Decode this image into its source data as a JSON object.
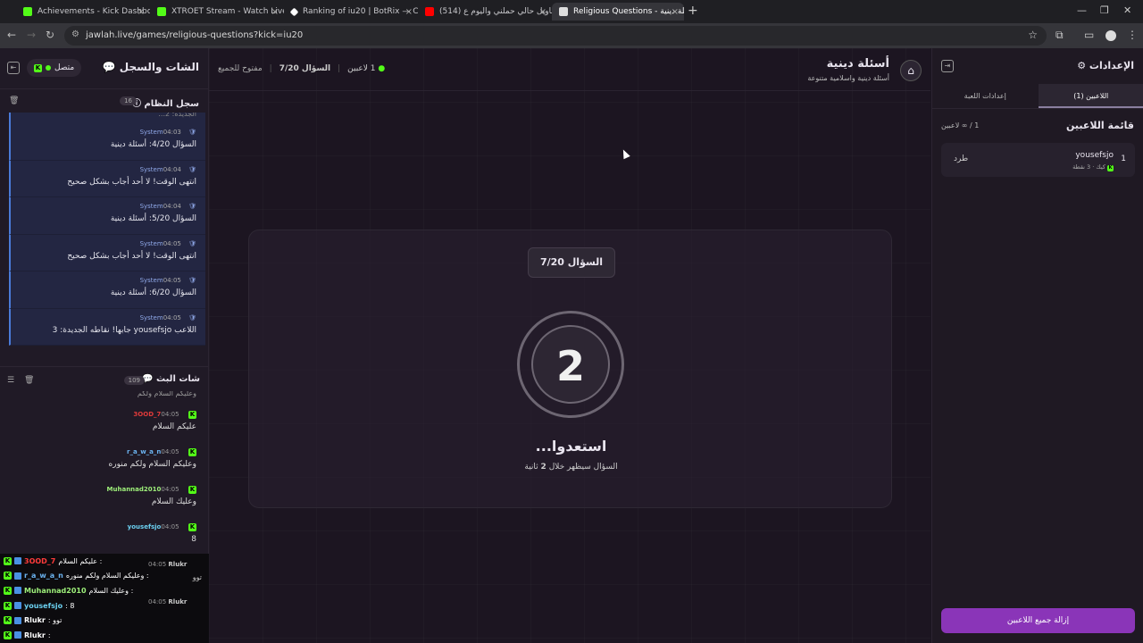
{
  "browser": {
    "tabs": [
      {
        "title": "Achievements - Kick Dashboard",
        "color": "#53fc18"
      },
      {
        "title": "XTROET Stream - Watch Live o",
        "color": "#53fc18"
      },
      {
        "title": "Ranking of iu20 | BotRix — Clou",
        "color": "#ffffff"
      },
      {
        "title": "(514) باويل حالي حملني واليوم ع",
        "color": "#ff0000"
      },
      {
        "title": "Religious Questions - أسئلة دينية",
        "color": "#ffffff"
      }
    ],
    "url": "jawlah.live/games/religious-questions?kick=iu20"
  },
  "left": {
    "title": "الشات والسجل",
    "online": "متصل",
    "system": {
      "title": "سجل النظام",
      "count": "16",
      "partial": "...الجديدة: 2",
      "messages": [
        {
          "sender": "System",
          "time": "04:03",
          "text": "السؤال 4/20: أسئلة دينية"
        },
        {
          "sender": "System",
          "time": "04:04",
          "text": "انتهى الوقت! لا أحد أجاب بشكل صحيح"
        },
        {
          "sender": "System",
          "time": "04:04",
          "text": "السؤال 5/20: أسئلة دينية"
        },
        {
          "sender": "System",
          "time": "04:05",
          "text": "انتهى الوقت! لا أحد أجاب بشكل صحيح"
        },
        {
          "sender": "System",
          "time": "04:05",
          "text": "السؤال 6/20: أسئلة دينية"
        },
        {
          "sender": "System",
          "time": "04:05",
          "text": "اللاعب yousefsjo جابها! نقاطه الجديدة: 3"
        }
      ]
    },
    "chat": {
      "title": "شات البث",
      "count": "109",
      "partial": "وعليكم السلام ولكم",
      "messages": [
        {
          "user": "3OOD_7",
          "time": "04:05",
          "text": "عليكم السلام",
          "color": "#e03a3a"
        },
        {
          "user": "r_a_w_a_n",
          "time": "04:05",
          "text": "وعليكم السلام ولكم منوره",
          "color": "#6bb3f0"
        },
        {
          "user": "Muhannad2010",
          "time": "04:05",
          "text": "وعليك السلام",
          "color": "#9ef07a"
        },
        {
          "user": "yousefsjo",
          "time": "04:05",
          "text": "8",
          "color": "#6bd0f0"
        }
      ]
    }
  },
  "overlay": [
    {
      "user": "3OOD_7",
      "text": "عليكم السلام :",
      "color": "#ff3b3b"
    },
    {
      "user": "r_a_w_a_n",
      "text": "وعليكم السلام ولكم منوره :",
      "color": "#6bb3f0"
    },
    {
      "user": "Muhannad2010",
      "text": "وعليك السلام :",
      "color": "#9ef07a"
    },
    {
      "user": "yousefsjo",
      "text": ": 8",
      "color": "#6bd0f0"
    },
    {
      "user": "Rlukr",
      "text": ": توو",
      "color": "#ffffff"
    },
    {
      "user": "Rlukr",
      "text": ":",
      "color": "#ffffff"
    }
  ],
  "overlay_side": [
    {
      "user": "Rlukr",
      "time": "04:05",
      "text": "توو"
    },
    {
      "user": "Rlukr",
      "time": "04:05",
      "text": ""
    }
  ],
  "center": {
    "title": "أسئلة دينية",
    "subtitle": "أسئلة دينية واسلامية متنوعة",
    "players": "1 لاعبين",
    "question": "السؤال 7/20",
    "status": "مفتوح للجميع",
    "badge": "السؤال 7/20",
    "countdown": "2",
    "ready": "استعدوا...",
    "sub_pre": "السؤال سيظهر خلال",
    "sub_num": "2",
    "sub_post": "ثانية"
  },
  "right": {
    "title": "الإعدادات",
    "tab_players": "اللاعبين (1)",
    "tab_settings": "إعدادات اللعبة",
    "list_title": "قائمة اللاعبين",
    "list_count": "1 / ∞ لاعبين",
    "player": {
      "rank": "1",
      "name": "yousefsjo",
      "info": "كيك · 3 نقطة",
      "kick": "طرد"
    },
    "clear": "إزالة جميع اللاعبين"
  }
}
